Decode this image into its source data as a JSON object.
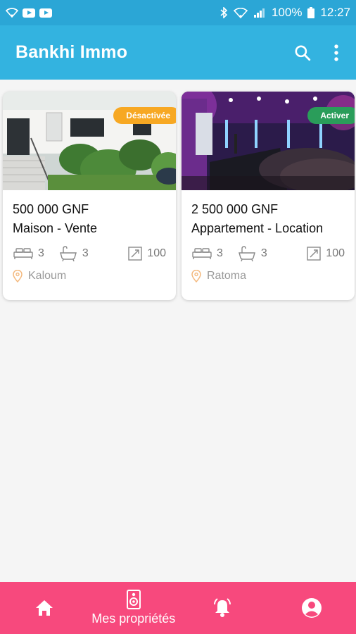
{
  "status_bar": {
    "battery": "100%",
    "time": "12:27"
  },
  "app": {
    "title": "Bankhi Immo"
  },
  "listings": [
    {
      "price": "500 000 GNF",
      "type": "Maison - Vente",
      "badge": "Désactivée",
      "beds": "3",
      "baths": "3",
      "area": "100",
      "location": "Kaloum"
    },
    {
      "price": "2 500 000 GNF",
      "type": "Appartement - Location",
      "badge": "Activer",
      "beds": "3",
      "baths": "3",
      "area": "100",
      "location": "Ratoma"
    }
  ],
  "bottom_nav": {
    "active_label": "Mes propriétés",
    "items": [
      "home-icon",
      "my-properties-icon",
      "bell-icon",
      "account-icon"
    ]
  },
  "colors": {
    "status": "#2ba6d6",
    "appbar": "#33b3e0",
    "nav": "#f7497d",
    "badge_off": "#f7a823",
    "badge_on": "#2a9d5a"
  }
}
